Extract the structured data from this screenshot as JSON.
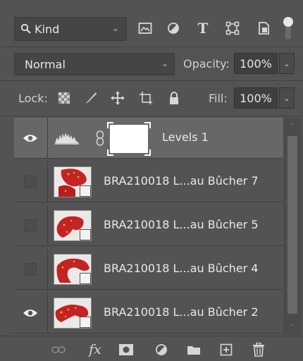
{
  "filter": {
    "kind_label": "Kind",
    "icons": [
      "image-filter-icon",
      "adjustment-filter-icon",
      "type-filter-icon",
      "shape-filter-icon",
      "smart-object-filter-icon"
    ]
  },
  "blend": {
    "mode": "Normal",
    "opacity_label": "Opacity:",
    "opacity_value": "100%"
  },
  "lock": {
    "label": "Lock:",
    "fill_label": "Fill:",
    "fill_value": "100%"
  },
  "layers": [
    {
      "name": "Levels 1",
      "visible": true,
      "selected": true,
      "kind": "adjustment"
    },
    {
      "name": "BRA210018 L...au Bûcher 7",
      "visible": false,
      "selected": false,
      "kind": "smart-object"
    },
    {
      "name": "BRA210018 L...au Bûcher 5",
      "visible": false,
      "selected": false,
      "kind": "smart-object"
    },
    {
      "name": "BRA210018 L...au Bûcher 4",
      "visible": false,
      "selected": false,
      "kind": "smart-object"
    },
    {
      "name": "BRA210018 L...au Bûcher 2",
      "visible": true,
      "selected": false,
      "kind": "smart-object"
    }
  ],
  "bottom_toolbar": {
    "fx_label": "fx",
    "icons": [
      "link-icon",
      "fx-icon",
      "mask-icon",
      "adjustment-icon",
      "folder-icon",
      "new-layer-icon",
      "trash-icon"
    ]
  },
  "colors": {
    "panel_bg": "#535353",
    "selected_row": "#676767",
    "thumb_red": "#c42323"
  }
}
